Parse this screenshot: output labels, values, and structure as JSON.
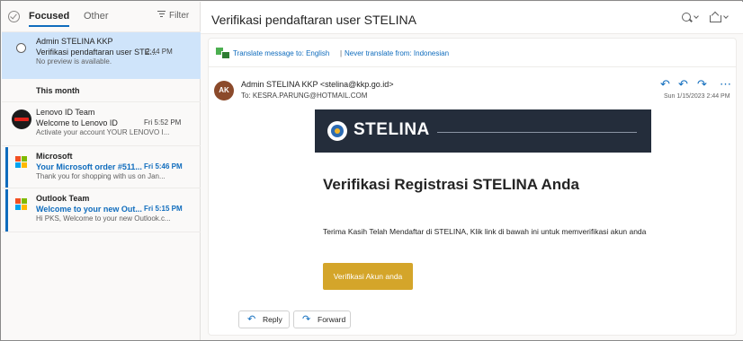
{
  "mail_list": {
    "tabs": {
      "focused": "Focused",
      "other": "Other"
    },
    "filter_label": "Filter",
    "selected_item": {
      "sender": "Admin STELINA KKP",
      "subject": "Verifikasi pendaftaran user STE...",
      "time": "2:44 PM",
      "preview": "No preview is available."
    },
    "group_header": "This month",
    "items": [
      {
        "sender": "Lenovo ID Team",
        "subject": "Welcome to Lenovo ID",
        "time": "Fri 5:52 PM",
        "preview": "Activate your account YOUR LENOVO I...",
        "icon": "lenovo-logo",
        "unread": false
      },
      {
        "sender": "Microsoft",
        "subject": "Your Microsoft order #511...",
        "time": "Fri 5:46 PM",
        "preview": "Thank you for shopping with us on Jan...",
        "icon": "microsoft-logo",
        "unread": true
      },
      {
        "sender": "Outlook Team",
        "subject": "Welcome to your new Out...",
        "time": "Fri 5:15 PM",
        "preview": "Hi PKS, Welcome to your new Outlook.c...",
        "icon": "microsoft-logo",
        "unread": true
      }
    ]
  },
  "reading_pane": {
    "subject": "Verifikasi pendaftaran user STELINA",
    "translate": {
      "link1": "Translate message to: English",
      "separator": "|",
      "link2": "Never translate from: Indonesian"
    },
    "sender": {
      "initials": "AK",
      "from": "Admin STELINA KKP <stelina@kkp.go.id>",
      "to": "To:  KESRA.PARUNG@HOTMAIL.COM",
      "date": "Sun 1/15/2023 2:44 PM"
    },
    "email": {
      "logo_text": "STELINA",
      "heading": "Verifikasi Registrasi STELINA Anda",
      "body": "Terima Kasih Telah Mendaftar di STELINA, Klik link di bawah ini untuk memverifikasi akun anda",
      "button": "Verifikasi Akun anda"
    },
    "actions": {
      "reply": "Reply",
      "forward": "Forward"
    },
    "colors": {
      "accent": "#0f6cbd",
      "selected_bg": "#cfe4fa",
      "banner_bg": "#242d3b",
      "button_bg": "#d4a52a",
      "avatar_bg": "#8b4a2b"
    }
  }
}
